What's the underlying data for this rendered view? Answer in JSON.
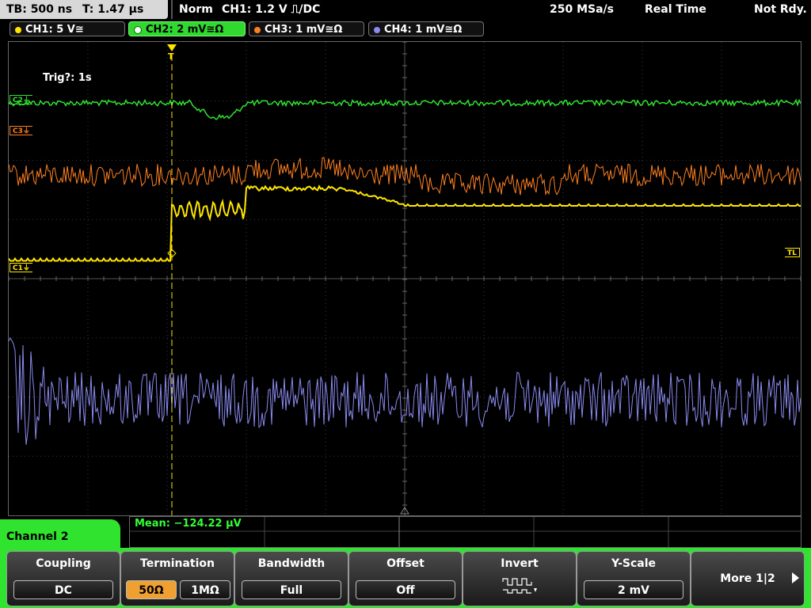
{
  "status": {
    "timebase": "TB: 500 ns",
    "time_pos": "T: 1.47 µs",
    "mode": "Norm",
    "trigger": "CH1: 1.2 V ⎍/DC",
    "sample_rate": "250 MSa/s",
    "acq_mode": "Real Time",
    "state": "Not Rdy."
  },
  "channels": [
    {
      "label": "CH1: 5 V≅",
      "color": "#ffe600"
    },
    {
      "label": "CH2: 2 mV≅Ω",
      "color": "#2fe32f"
    },
    {
      "label": "CH3: 1 mV≅Ω",
      "color": "#ff8020"
    },
    {
      "label": "CH4: 1 mV≅Ω",
      "color": "#8a8af0"
    }
  ],
  "trace_markers": {
    "c1": "C1⏚",
    "c2": "C2⏚",
    "c3": "C3⏚",
    "tl": "TL"
  },
  "trigger_marker": "T",
  "trig_msg": "Trig?: 1s",
  "measurement": "Mean: −124.22 µV",
  "menu_title": "Channel 2",
  "softkeys": {
    "coupling": {
      "title": "Coupling",
      "value": "DC"
    },
    "termination": {
      "title": "Termination",
      "opt1": "50Ω",
      "opt2": "1MΩ"
    },
    "bandwidth": {
      "title": "Bandwidth",
      "value": "Full"
    },
    "offset": {
      "title": "Offset",
      "value": "Off"
    },
    "invert": {
      "title": "Invert",
      "icon": "invert-waveform-icon"
    },
    "yscale": {
      "title": "Y-Scale",
      "value": "2 mV"
    },
    "more": {
      "label": "More 1|2"
    }
  }
}
